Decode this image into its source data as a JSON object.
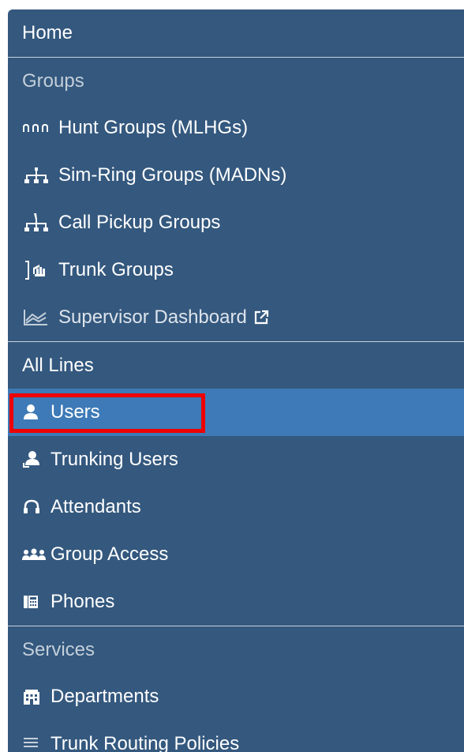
{
  "nav": {
    "home": "Home",
    "groups": {
      "header": "Groups",
      "items": [
        {
          "label": "Hunt Groups (MLHGs)",
          "icon": "hunt-groups-icon"
        },
        {
          "label": "Sim-Ring Groups (MADNs)",
          "icon": "sim-ring-icon"
        },
        {
          "label": "Call Pickup Groups",
          "icon": "call-pickup-icon"
        },
        {
          "label": "Trunk Groups",
          "icon": "trunk-groups-icon"
        },
        {
          "label": "Supervisor Dashboard",
          "icon": "dashboard-chart-icon",
          "external": true
        }
      ]
    },
    "all_lines": {
      "header": "All Lines",
      "items": [
        {
          "label": "Users",
          "icon": "user-icon",
          "active": true
        },
        {
          "label": "Trunking Users",
          "icon": "trunking-user-icon"
        },
        {
          "label": "Attendants",
          "icon": "headset-icon"
        },
        {
          "label": "Group Access",
          "icon": "users-group-icon"
        },
        {
          "label": "Phones",
          "icon": "phone-icon"
        }
      ]
    },
    "services": {
      "header": "Services",
      "items": [
        {
          "label": "Departments",
          "icon": "building-icon"
        },
        {
          "label": "Trunk Routing Policies",
          "icon": "list-icon"
        }
      ]
    }
  },
  "colors": {
    "sidebar_bg": "#34587e",
    "active_bg": "#3d7ab7",
    "highlight_box": "#ee0000",
    "divider": "#c9d3dd"
  }
}
